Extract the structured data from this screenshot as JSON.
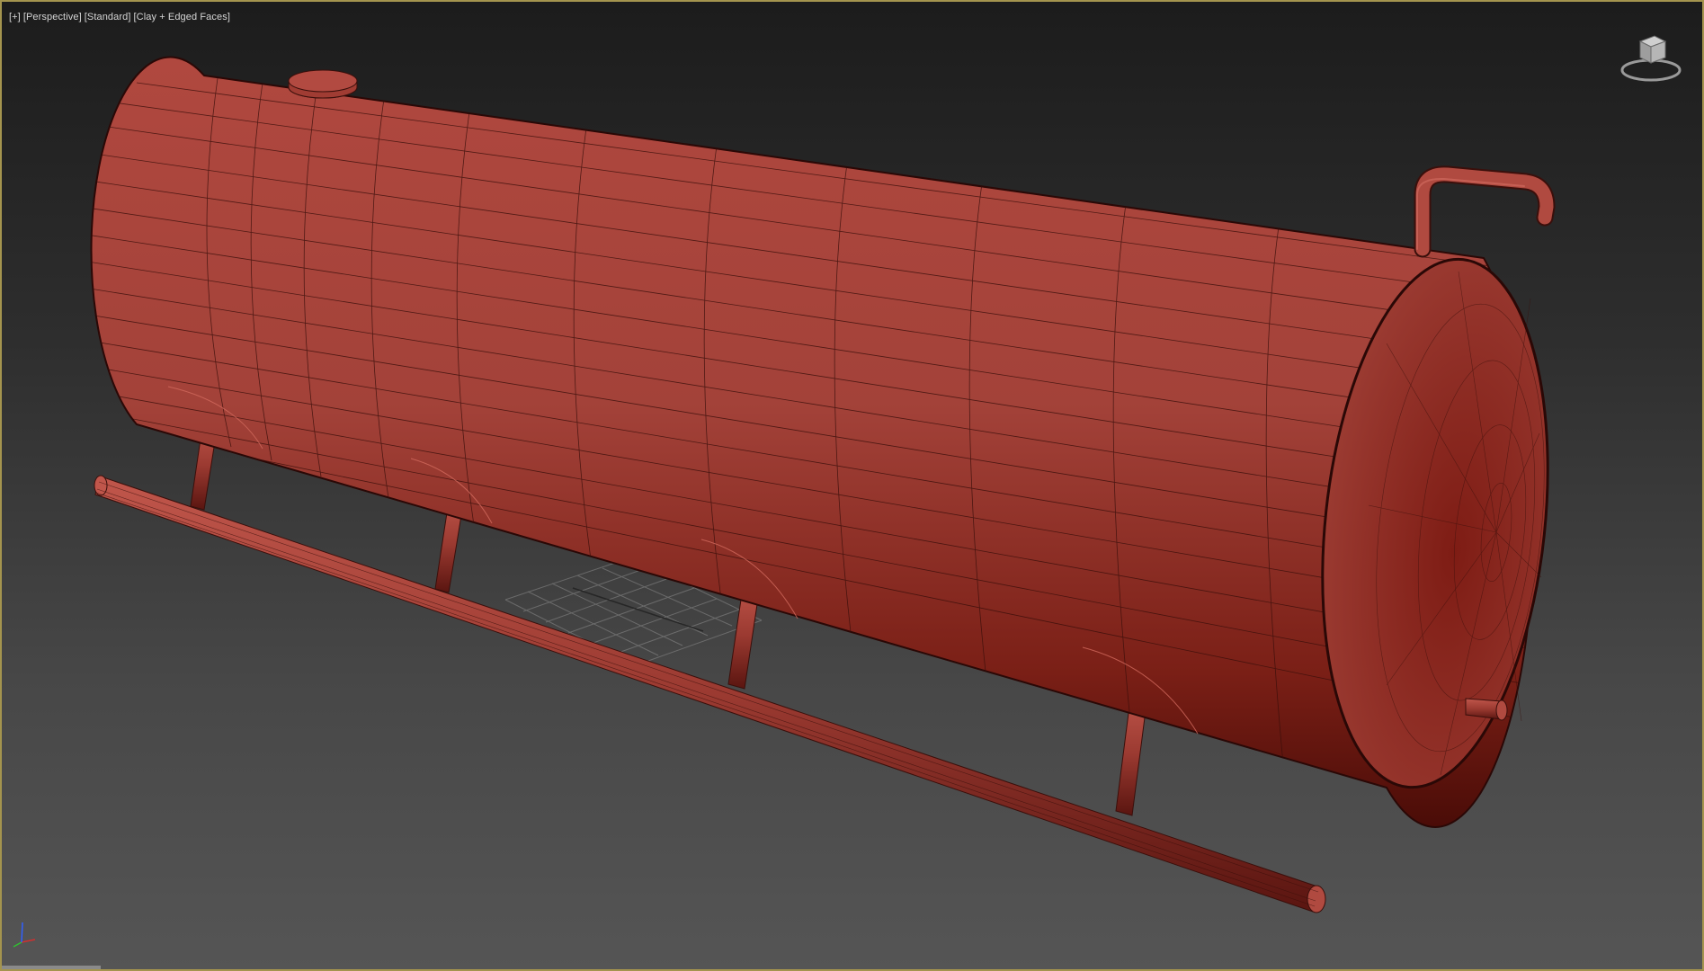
{
  "viewport": {
    "label_parts": [
      "[+]",
      "[Perspective]",
      "[Standard]",
      "[Clay + Edged Faces]"
    ],
    "projection": "Perspective",
    "display_style": "Clay + Edged Faces",
    "border_color": "#a4944e"
  },
  "scene": {
    "object": "horizontal storage tank",
    "material_color": "#b44a3f",
    "wire_color": "#3a0f0b",
    "grid_color": "#8c8c8c"
  },
  "icons": {
    "viewcube": "viewcube-icon",
    "axis": "axis-tripod-icon"
  },
  "axis_colors": {
    "x": "#d03030",
    "y": "#30c030",
    "z": "#3060ff"
  }
}
